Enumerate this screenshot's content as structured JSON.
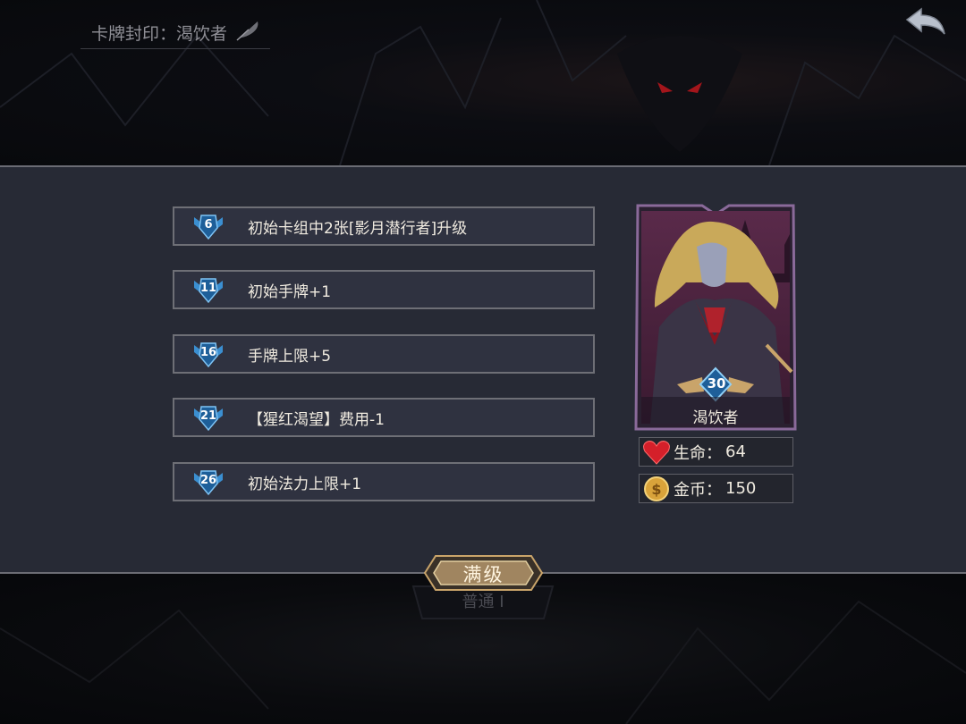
{
  "header": {
    "breadcrumb": "卡牌封印：渴饮者"
  },
  "bonuses": [
    {
      "level": "6",
      "text": "初始卡组中2张[影月潜行者]升级"
    },
    {
      "level": "11",
      "text": "初始手牌+1"
    },
    {
      "level": "16",
      "text": "手牌上限+5"
    },
    {
      "level": "21",
      "text": "【猩红渴望】费用-1"
    },
    {
      "level": "26",
      "text": "初始法力上限+1"
    }
  ],
  "character": {
    "name": "渴饮者",
    "level": "30"
  },
  "stats": {
    "life_label": "生命：",
    "life_value": "64",
    "gold_label": "金币：",
    "gold_value": "150"
  },
  "actions": {
    "max_level_label": "满级",
    "difficulty_label": "普通 I"
  },
  "icons": {
    "back": "back-arrow-icon",
    "quill": "quill-icon",
    "heart": "heart-icon",
    "coin": "coin-icon",
    "level_badge": "winged-shield-badge-icon"
  },
  "colors": {
    "panel": "#272a35",
    "row_border": "#6e6f76",
    "badge_blue": "#2b78b8",
    "gold": "#c9a46a"
  }
}
